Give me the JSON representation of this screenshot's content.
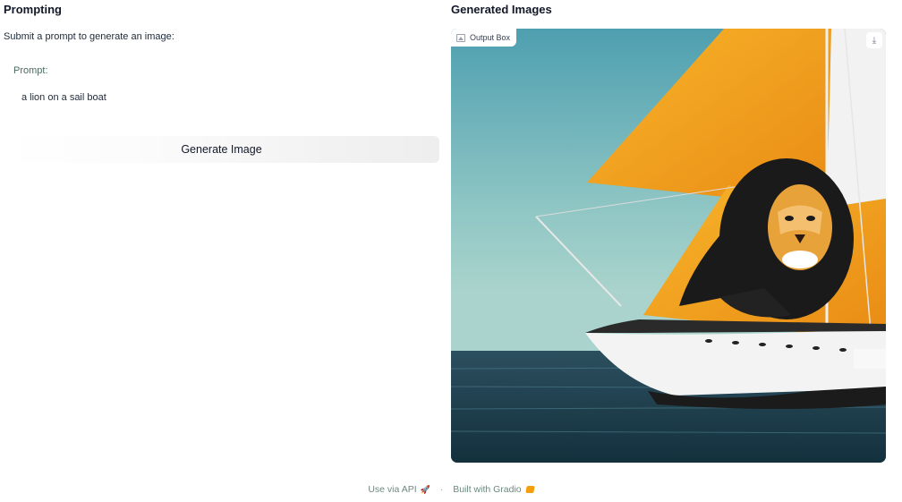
{
  "prompting": {
    "title": "Prompting",
    "instructions": "Submit a prompt to generate an image:",
    "prompt_label": "Prompt:",
    "prompt_value": "a lion on a sail boat",
    "generate_label": "Generate Image"
  },
  "output": {
    "title": "Generated Images",
    "tag_label": "Output Box",
    "image_icon": "image-icon",
    "download_icon": "download-icon",
    "image_subject": "a lion on a sail boat"
  },
  "footer": {
    "api_label": "Use via API",
    "api_icon": "rocket-icon",
    "separator": "·",
    "built_label": "Built with Gradio",
    "built_icon": "gradio-logo"
  },
  "colors": {
    "sky": "#5aa9b6",
    "sail": "#f4a21c",
    "sea": "#1e3b4a",
    "hull": "#f3f3f3",
    "lion_mane": "#1a1a1a"
  }
}
